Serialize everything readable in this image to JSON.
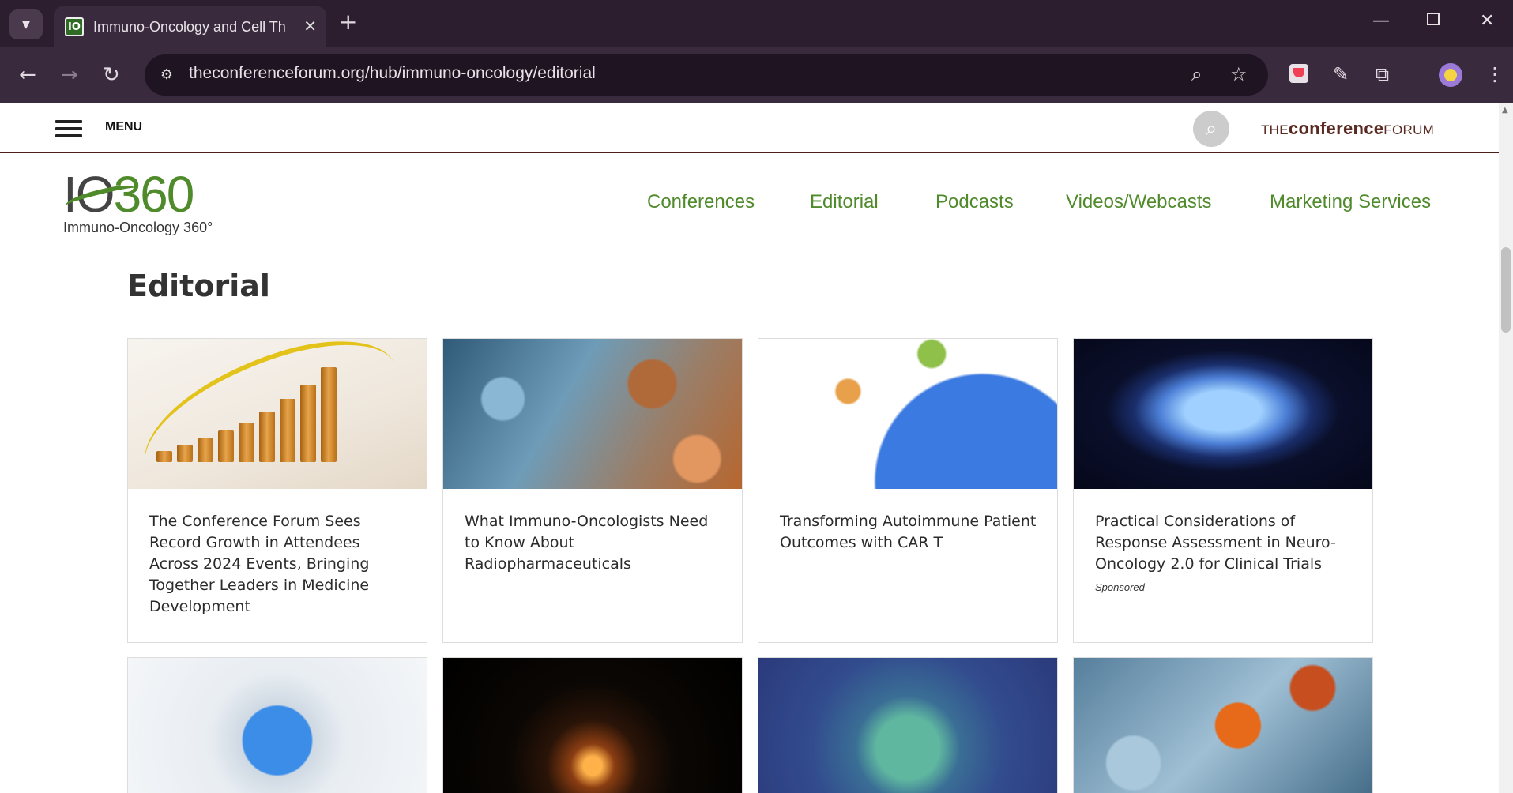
{
  "browser": {
    "tab_title": "Immuno-Oncology and Cell Th",
    "favicon_text": "IO",
    "url": "theconferenceforum.org/hub/immuno-oncology/editorial",
    "icons": [
      "tab-search-icon",
      "close-icon",
      "plus-icon",
      "minimize-icon",
      "maximize-icon",
      "window-close-icon",
      "back-icon",
      "forward-icon",
      "reload-icon",
      "site-info-icon",
      "zoom-icon",
      "star-icon",
      "pocket-icon",
      "pen-icon",
      "extensions-icon",
      "profile-avatar",
      "kebab-menu-icon"
    ]
  },
  "header": {
    "menu_label": "MENU",
    "brand_the": "THE",
    "brand_conference": "conference",
    "brand_forum": "FORUM",
    "brand_color": "#5a2a22"
  },
  "logo": {
    "io": "IO",
    "num": "360",
    "subtitle": "Immuno-Oncology 360°",
    "accent": "#4f8a2b"
  },
  "nav": {
    "items": [
      {
        "label": "Conferences"
      },
      {
        "label": "Editorial"
      },
      {
        "label": "Podcasts"
      },
      {
        "label": "Videos/Webcasts"
      },
      {
        "label": "Marketing Services"
      }
    ],
    "color": "#4f8a2b"
  },
  "page": {
    "title": "Editorial"
  },
  "cards": [
    {
      "title": "The Conference Forum Sees Record Growth in Attendees Across 2024 Events, Bringing Together Leaders in Medicine Development",
      "image": "growth-chart-image",
      "sponsored": ""
    },
    {
      "title": "What Immuno-Oncologists Need to Know About Radiopharmaceuticals",
      "image": "cancer-cells-image",
      "sponsored": ""
    },
    {
      "title": "Transforming Autoimmune Patient Outcomes with CAR T",
      "image": "car-t-cells-image",
      "sponsored": ""
    },
    {
      "title": "Practical Considerations of Response Assessment in Neuro-Oncology 2.0 for Clinical Trials",
      "image": "brain-scan-image",
      "sponsored": "Sponsored"
    },
    {
      "image": "puzzle-magnifier-image"
    },
    {
      "image": "light-bulb-image"
    },
    {
      "image": "t-cell-image"
    },
    {
      "image": "tumor-cells-image"
    }
  ]
}
